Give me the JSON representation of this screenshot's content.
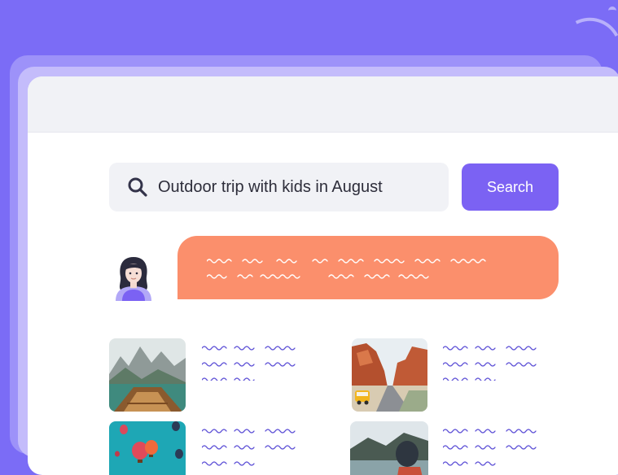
{
  "search": {
    "query": "Outdoor trip with kids in August",
    "button_label": "Search"
  },
  "colors": {
    "background": "#7b6cf6",
    "accent": "#7b62f3",
    "bubble": "#fb8f6c",
    "card": "#ffffff",
    "header": "#f1f2f6"
  },
  "icons": {
    "search": "magnifier-icon",
    "avatar": "user-avatar-icon"
  },
  "results": [
    {
      "image": "mountain-lake-boat-image"
    },
    {
      "image": "desert-van-road-image"
    },
    {
      "image": "hot-air-balloons-image"
    },
    {
      "image": "kayak-lake-image"
    }
  ]
}
